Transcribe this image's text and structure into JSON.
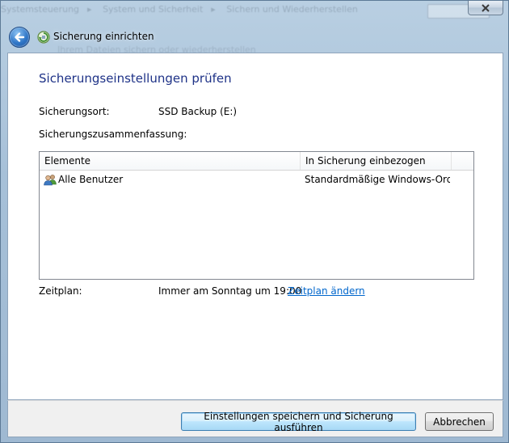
{
  "background": {
    "breadcrumbs": [
      "Systemsteuerung",
      "System und Sicherheit",
      "Sichern und Wiederherstellen"
    ],
    "ghost_text": "Ihrem Dateien sichern oder wiederherstellen"
  },
  "window": {
    "title": "Sicherung einrichten"
  },
  "page": {
    "heading": "Sicherungseinstellungen prüfen",
    "location_label": "Sicherungsort:",
    "location_value": "SSD Backup (E:)",
    "summary_label": "Sicherungszusammenfassung:"
  },
  "summary_table": {
    "columns": [
      "Elemente",
      "In Sicherung einbezogen"
    ],
    "rows": [
      {
        "item": "Alle Benutzer",
        "included": "Standardmäßige Windows-Ord..."
      }
    ]
  },
  "schedule": {
    "label": "Zeitplan:",
    "value": "Immer am Sonntag um 19:00",
    "change_link": "Zeitplan ändern"
  },
  "buttons": {
    "save_run": "Einstellungen speichern und Sicherung ausführen",
    "cancel": "Abbrechen"
  },
  "colors": {
    "heading": "#1e3287",
    "link": "#0066cc",
    "default_button_border": "#3c7fb1"
  },
  "icons": {
    "back": "back-arrow-icon",
    "title": "backup-icon",
    "close": "close-icon",
    "users": "users-icon"
  }
}
